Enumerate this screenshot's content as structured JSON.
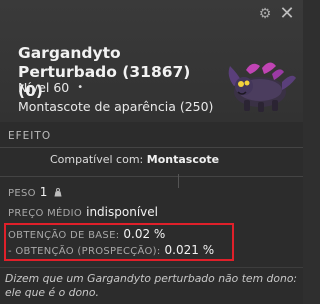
{
  "header": {
    "title": "Gargandyto Perturbado (31867) (0)",
    "level_label": "Nível 60",
    "level_marker": "•",
    "type_label": "Montascote de aparência (250)"
  },
  "section": {
    "effect_title": "EFEITO"
  },
  "effect": {
    "prefix": "Compatível com:",
    "target": "Montascote"
  },
  "stats": {
    "weight_label": "PESO",
    "weight_value": "1",
    "price_label": "PREÇO MÉDIO",
    "price_value": "indisponível",
    "base_obtain_label": "OBTENÇÃO DE BASE:",
    "base_obtain_value": "0.02 %",
    "prospect_obtain_label": "- OBTENÇÃO (PROSPECÇÃO):",
    "prospect_obtain_value": "0.021 %"
  },
  "flavor_text": "Dizem que um Gargandyto perturbado não tem dono: ele que é o dono.",
  "icons": {
    "settings": "gear-icon",
    "close": "close-icon",
    "weight": "weight-icon",
    "creature": "creature-image"
  },
  "colors": {
    "highlight_border": "#e0202a",
    "background": "#2c2c2c"
  }
}
